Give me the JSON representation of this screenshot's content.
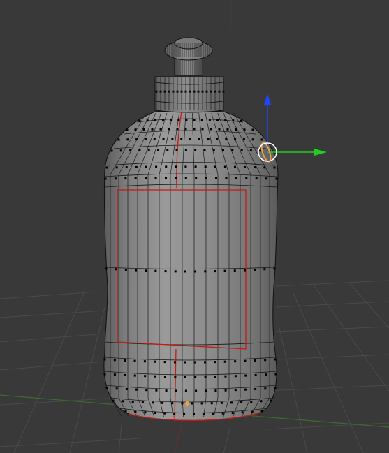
{
  "viewport": {
    "background": "#393939",
    "grid_color": "#4a4a4a",
    "x_axis_color": "#6b2e2e",
    "y_axis_color": "#3e6b30"
  },
  "mesh": {
    "object": "bottle",
    "mode": "edit",
    "face_color": "#8a8a8a",
    "wire_color": "#101010",
    "vertex_color": "#000000",
    "seam_color": "#c81a10",
    "selected_vertex_color": "#f0a040"
  },
  "gizmo": {
    "icon": "translate-manipulator-icon",
    "z_color": "#2244ff",
    "y_color": "#22cc22",
    "center_color": "#ffffff"
  }
}
